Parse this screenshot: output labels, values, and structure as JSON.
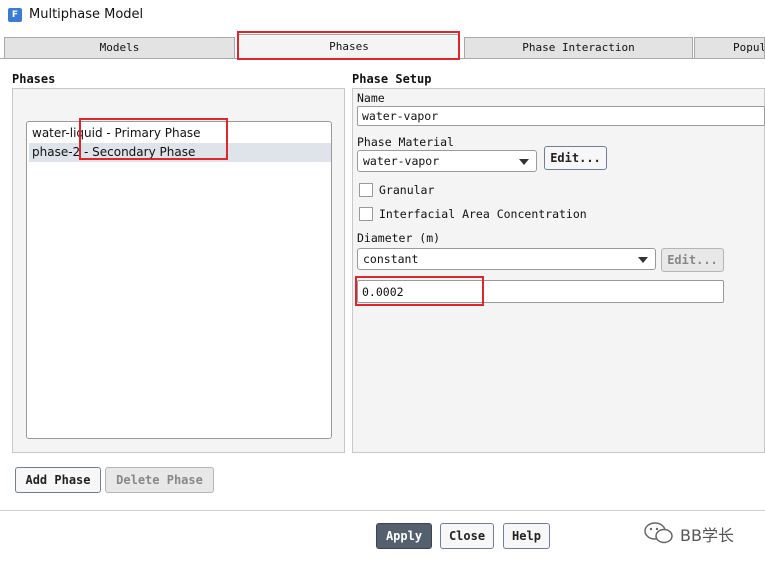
{
  "window": {
    "title": "Multiphase Model",
    "icon": "fluent-app-icon",
    "icon_letter": "F"
  },
  "tabs": [
    {
      "label": "Models",
      "active": false
    },
    {
      "label": "Phases",
      "active": true
    },
    {
      "label": "Phase Interaction",
      "active": false
    },
    {
      "label": "Popul",
      "active": false
    }
  ],
  "phases_group": {
    "label": "Phases",
    "items": [
      {
        "label": "water-liquid - Primary Phase",
        "selected": false
      },
      {
        "label": "phase-2 - Secondary Phase",
        "selected": true
      }
    ],
    "add_button": "Add Phase",
    "delete_button": "Delete Phase"
  },
  "phase_setup": {
    "label": "Phase Setup",
    "name_label": "Name",
    "name_value": "water-vapor",
    "material_label": "Phase Material",
    "material_value": "water-vapor",
    "material_edit": "Edit...",
    "granular_label": "Granular",
    "granular_checked": false,
    "iac_label": "Interfacial Area Concentration",
    "iac_checked": false,
    "diameter_label": "Diameter (m)",
    "diameter_method": "constant",
    "diameter_edit": "Edit...",
    "diameter_value": "0.0002"
  },
  "footer": {
    "apply": "Apply",
    "close": "Close",
    "help": "Help"
  },
  "watermark": {
    "text": "BB学长",
    "icon": "wechat-icon"
  },
  "colors": {
    "highlight_box": "#e0262b",
    "selected_row": "#dfe3ea",
    "apply_button": "#55606f"
  }
}
